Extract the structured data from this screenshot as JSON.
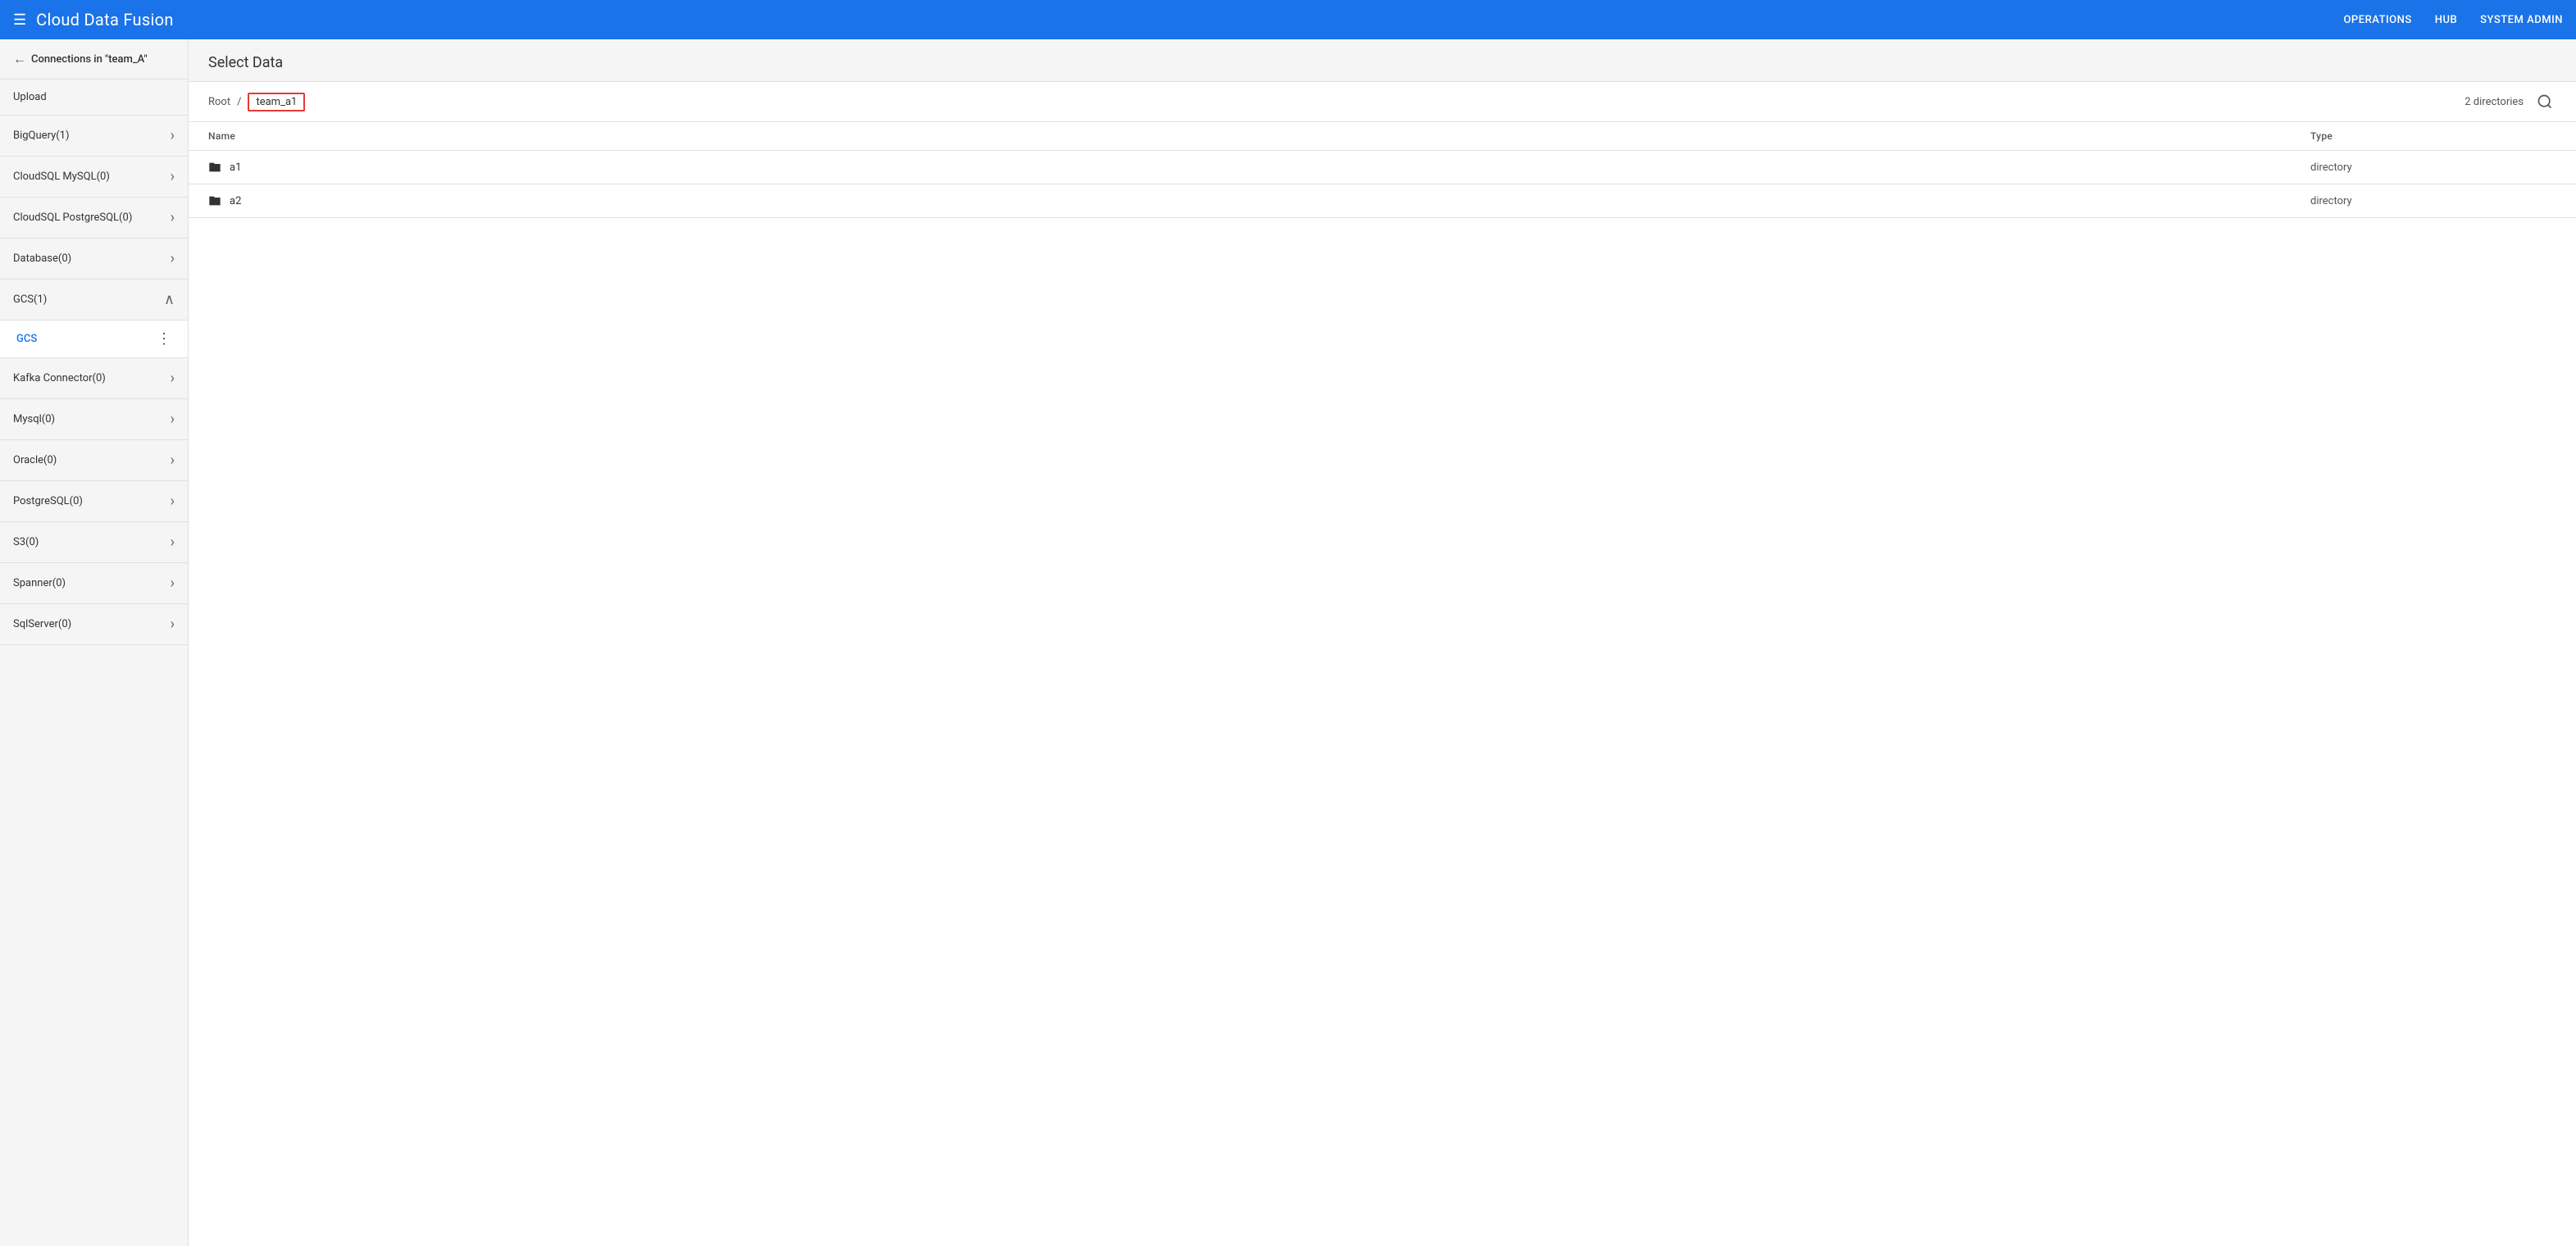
{
  "app": {
    "title": "Cloud Data Fusion",
    "nav": {
      "operations": "OPERATIONS",
      "hub": "HUB",
      "system_admin": "SYSTEM ADMIN"
    }
  },
  "sidebar": {
    "back_label": "Connections in \"team_A\"",
    "upload_label": "Upload",
    "items": [
      {
        "id": "bigquery",
        "label": "BigQuery(1)",
        "expanded": false
      },
      {
        "id": "cloudsql-mysql",
        "label": "CloudSQL MySQL(0)",
        "expanded": false
      },
      {
        "id": "cloudsql-postgres",
        "label": "CloudSQL PostgreSQL(0)",
        "expanded": false
      },
      {
        "id": "database",
        "label": "Database(0)",
        "expanded": false
      },
      {
        "id": "gcs",
        "label": "GCS(1)",
        "expanded": true
      },
      {
        "id": "kafka",
        "label": "Kafka Connector(0)",
        "expanded": false
      },
      {
        "id": "mysql",
        "label": "Mysql(0)",
        "expanded": false
      },
      {
        "id": "oracle",
        "label": "Oracle(0)",
        "expanded": false
      },
      {
        "id": "postgresql",
        "label": "PostgreSQL(0)",
        "expanded": false
      },
      {
        "id": "s3",
        "label": "S3(0)",
        "expanded": false
      },
      {
        "id": "spanner",
        "label": "Spanner(0)",
        "expanded": false
      },
      {
        "id": "sqlserver",
        "label": "SqlServer(0)",
        "expanded": false
      }
    ],
    "gcs_subitem": {
      "label": "GCS"
    }
  },
  "content": {
    "title": "Select Data",
    "breadcrumb": {
      "root": "Root",
      "separator": "/",
      "current": "team_a1"
    },
    "dir_count": "2 directories",
    "table": {
      "col_name": "Name",
      "col_type": "Type",
      "rows": [
        {
          "name": "a1",
          "type": "directory"
        },
        {
          "name": "a2",
          "type": "directory"
        }
      ]
    }
  },
  "icons": {
    "hamburger": "☰",
    "back_arrow": "←",
    "chevron_down": "⌄",
    "chevron_up": "⌃",
    "dots": "⋮",
    "folder": "📁",
    "search": "🔍"
  }
}
